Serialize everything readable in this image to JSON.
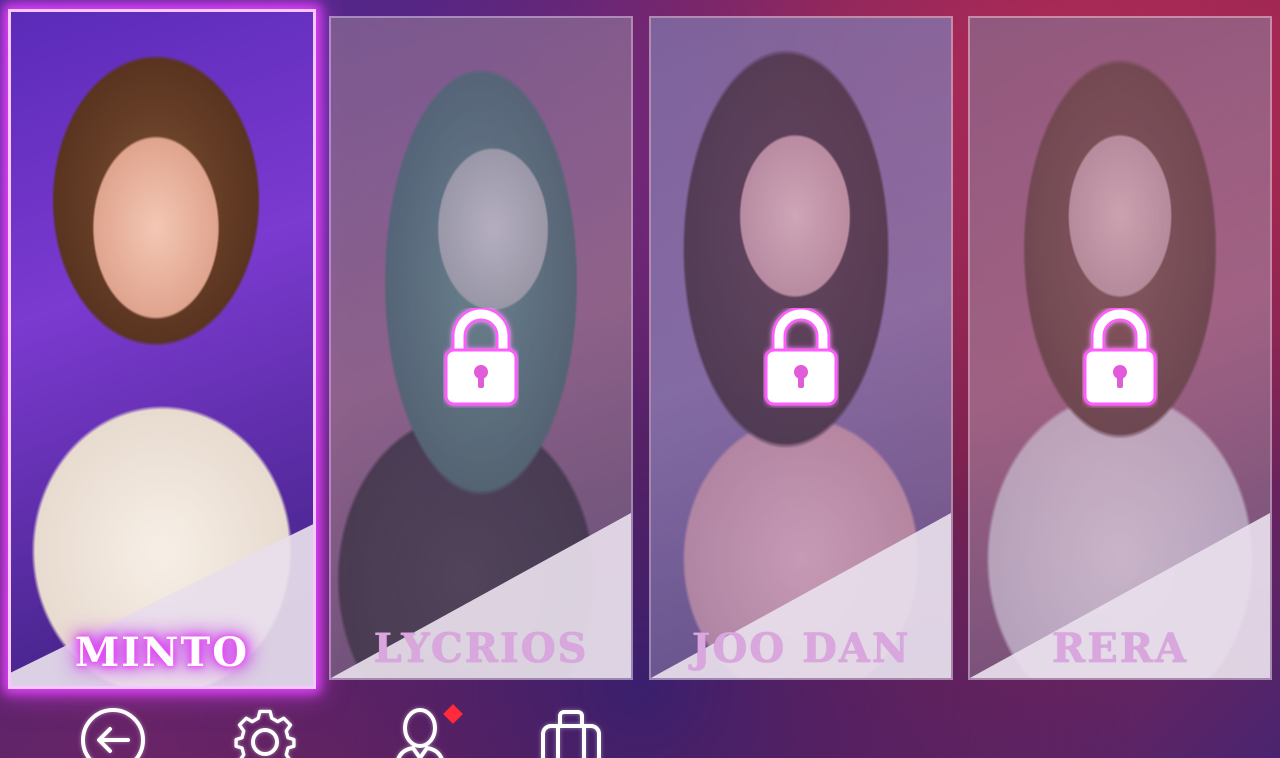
{
  "characters": [
    {
      "name": "MINTO",
      "selected": true,
      "locked": false
    },
    {
      "name": "LYCRIOS",
      "selected": false,
      "locked": true
    },
    {
      "name": "JOO DAN",
      "selected": false,
      "locked": true
    },
    {
      "name": "RERA",
      "selected": false,
      "locked": true
    }
  ],
  "bottom_bar": {
    "back_icon": "back-arrow-circle-icon",
    "settings_icon": "gear-icon",
    "profile_icon": "user-icon",
    "profile_badge": "red-diamond-notification",
    "inventory_icon": "suitcase-icon"
  },
  "colors": {
    "selected_glow": "#e040fb",
    "lock_glow": "#ff4dff",
    "notification": "#ff2a3a"
  }
}
